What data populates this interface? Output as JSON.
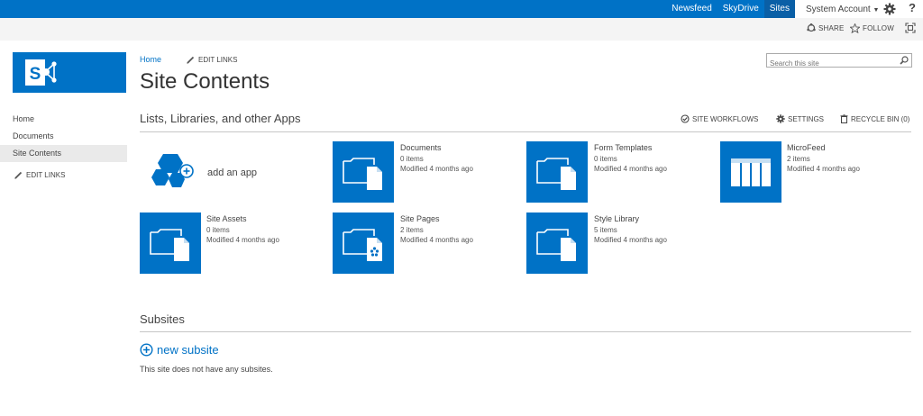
{
  "suite_bar": {
    "links": [
      "Newsfeed",
      "SkyDrive",
      "Sites"
    ],
    "active_link": "Sites",
    "account": "System Account",
    "help": "?"
  },
  "ribbon": {
    "share": "SHARE",
    "follow": "FOLLOW"
  },
  "top_nav": {
    "home": "Home",
    "edit_links": "EDIT LINKS"
  },
  "page_title": "Site Contents",
  "search": {
    "placeholder": "Search this site"
  },
  "left_nav": {
    "items": [
      "Home",
      "Documents",
      "Site Contents"
    ],
    "selected": "Site Contents",
    "edit_links": "EDIT LINKS"
  },
  "lists_section": {
    "heading": "Lists, Libraries, and other Apps",
    "tools": {
      "workflows": "SITE WORKFLOWS",
      "settings": "SETTINGS",
      "recycle_bin": "RECYCLE BIN (0)"
    },
    "add_app": "add an app",
    "tiles": [
      {
        "name": "Documents",
        "count": "0 items",
        "modified": "Modified 4 months ago",
        "icon": "folder-document-icon"
      },
      {
        "name": "Form Templates",
        "count": "0 items",
        "modified": "Modified 4 months ago",
        "icon": "folder-document-icon"
      },
      {
        "name": "MicroFeed",
        "count": "2 items",
        "modified": "Modified 4 months ago",
        "icon": "list-grid-icon"
      },
      {
        "name": "Site Assets",
        "count": "0 items",
        "modified": "Modified 4 months ago",
        "icon": "folder-document-icon"
      },
      {
        "name": "Site Pages",
        "count": "2 items",
        "modified": "Modified 4 months ago",
        "icon": "folder-page-icon"
      },
      {
        "name": "Style Library",
        "count": "5 items",
        "modified": "Modified 4 months ago",
        "icon": "folder-document-icon"
      }
    ]
  },
  "subsites_section": {
    "heading": "Subsites",
    "new_subsite": "new subsite",
    "empty_message": "This site does not have any subsites."
  },
  "colors": {
    "brand": "#0072c6",
    "suite_bar": "#0072c6",
    "ribbon": "#f4f4f4",
    "selected_nav": "#eaeaea"
  }
}
